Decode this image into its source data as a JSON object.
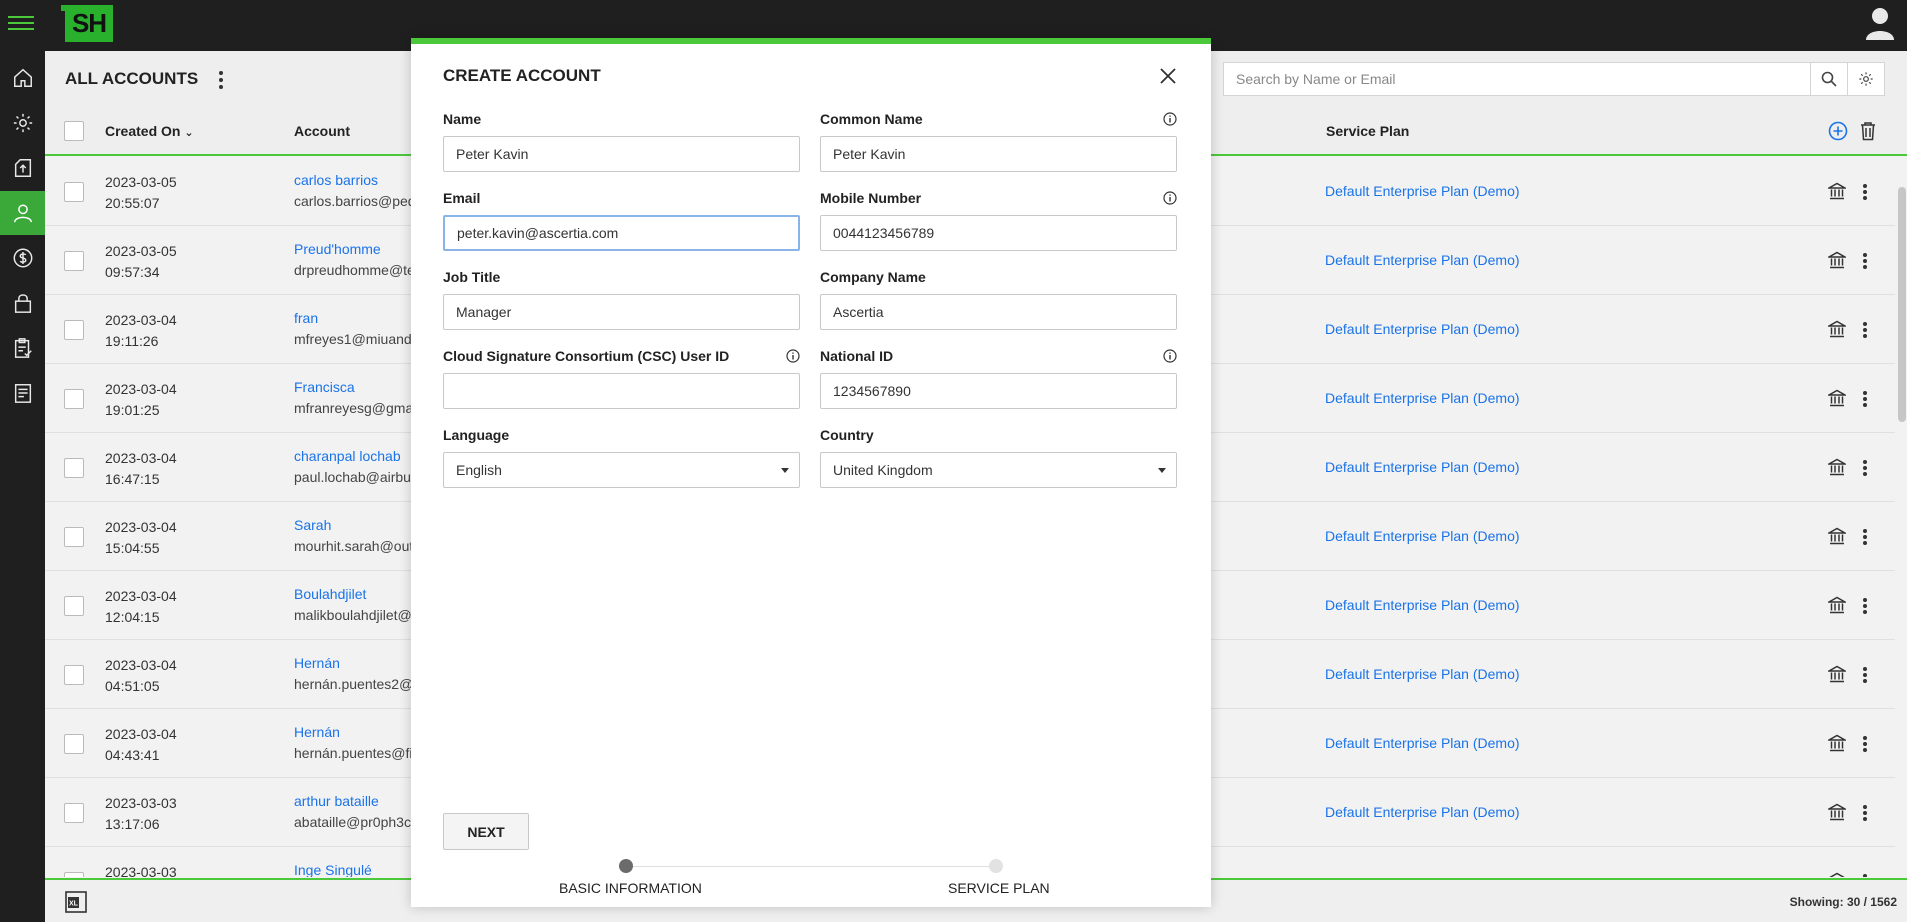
{
  "app": {
    "logo_text": "SH"
  },
  "header": {
    "title": "ALL ACCOUNTS",
    "search_placeholder": "Search by Name or Email"
  },
  "table": {
    "columns": {
      "created_on": "Created On",
      "account": "Account",
      "service_plan": "Service Plan"
    },
    "rows": [
      {
        "date": "2023-03-05",
        "time": "20:55:07",
        "name": "carlos barrios",
        "email": "carlos.barrios@ped",
        "plan": "Default Enterprise Plan (Demo)"
      },
      {
        "date": "2023-03-05",
        "time": "09:57:34",
        "name": "Preud'homme",
        "email": "drpreudhomme@te",
        "plan": "Default Enterprise Plan (Demo)"
      },
      {
        "date": "2023-03-04",
        "time": "19:11:26",
        "name": "fran",
        "email": "mfreyes1@miuand",
        "plan": "Default Enterprise Plan (Demo)"
      },
      {
        "date": "2023-03-04",
        "time": "19:01:25",
        "name": "Francisca",
        "email": "mfranreyesg@gma",
        "plan": "Default Enterprise Plan (Demo)"
      },
      {
        "date": "2023-03-04",
        "time": "16:47:15",
        "name": "charanpal lochab",
        "email": "paul.lochab@airbu",
        "plan": "Default Enterprise Plan (Demo)"
      },
      {
        "date": "2023-03-04",
        "time": "15:04:55",
        "name": "Sarah",
        "email": "mourhit.sarah@out",
        "plan": "Default Enterprise Plan (Demo)"
      },
      {
        "date": "2023-03-04",
        "time": "12:04:15",
        "name": "Boulahdjilet",
        "email": "malikboulahdjilet@",
        "plan": "Default Enterprise Plan (Demo)"
      },
      {
        "date": "2023-03-04",
        "time": "04:51:05",
        "name": "Hernán",
        "email": "hernán.puentes2@",
        "plan": "Default Enterprise Plan (Demo)"
      },
      {
        "date": "2023-03-04",
        "time": "04:43:41",
        "name": "Hernán",
        "email": "hernán.puentes@fi",
        "plan": "Default Enterprise Plan (Demo)"
      },
      {
        "date": "2023-03-03",
        "time": "13:17:06",
        "name": "arthur bataille",
        "email": "abataille@pr0ph3c",
        "plan": "Default Enterprise Plan (Demo)"
      },
      {
        "date": "2023-03-03",
        "time": "",
        "name": "Inge Singulé",
        "email": "",
        "plan": ""
      }
    ]
  },
  "footer": {
    "showing": "Showing: 30 / 1562"
  },
  "modal": {
    "title": "CREATE ACCOUNT",
    "fields": {
      "name": {
        "label": "Name",
        "value": "Peter Kavin"
      },
      "common_name": {
        "label": "Common Name",
        "value": "Peter Kavin"
      },
      "email": {
        "label": "Email",
        "value": "peter.kavin@ascertia.com"
      },
      "mobile": {
        "label": "Mobile Number",
        "value": "0044123456789"
      },
      "job_title": {
        "label": "Job Title",
        "value": "Manager"
      },
      "company": {
        "label": "Company Name",
        "value": "Ascertia"
      },
      "csc_user_id": {
        "label": "Cloud Signature Consortium (CSC) User ID",
        "value": ""
      },
      "national_id": {
        "label": "National ID",
        "value": "1234567890"
      },
      "language": {
        "label": "Language",
        "value": "English"
      },
      "country": {
        "label": "Country",
        "value": "United Kingdom"
      }
    },
    "next_label": "NEXT",
    "steps": [
      {
        "label": "BASIC INFORMATION",
        "active": true
      },
      {
        "label": "SERVICE PLAN",
        "active": false
      }
    ]
  },
  "colors": {
    "accent_green": "#4cc93a",
    "link_blue": "#1a73e8",
    "dark_bar": "#1f1f1f"
  },
  "icons": [
    "menu-icon",
    "home-icon",
    "gear-icon",
    "upload-icon",
    "user-icon",
    "dollar-icon",
    "lock-icon",
    "clipboard-check-icon",
    "report-icon",
    "search-icon",
    "settings-icon",
    "add-icon",
    "trash-icon",
    "bank-icon",
    "close-icon",
    "info-icon",
    "excel-icon",
    "avatar-icon"
  ]
}
